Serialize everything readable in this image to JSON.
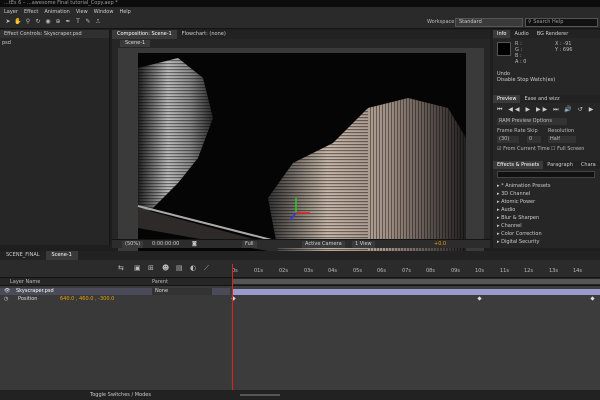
{
  "window": {
    "title": "...tEs 6 – ...awesome Final tutorial_Copy.aep *"
  },
  "menu": [
    "Layer",
    "Effect",
    "Animation",
    "View",
    "Window",
    "Help"
  ],
  "toolbar": {
    "workspace_label": "Workspace:",
    "workspace_value": "Standard",
    "search_placeholder": "Search Help"
  },
  "effect_controls": {
    "tab": "Effect Controls: Skyscraper.psd",
    "item": "psd"
  },
  "composition": {
    "tab": "Composition: Scene-1",
    "flowchart_tab": "Flowchart: (none)",
    "scene_tab": "Scene-1",
    "zoom": "(50%)",
    "timecode": "0:00:00:00",
    "resolution": "Full",
    "camera": "Active Camera",
    "views": "1 View",
    "exposure": "+0.0"
  },
  "info_panel": {
    "tabs": [
      "Info",
      "Audio",
      "BG Renderer"
    ],
    "labels": [
      "R :",
      "G :",
      "B :",
      "A : 0"
    ],
    "coords": [
      "X : -91",
      "Y : 696"
    ],
    "undo_title": "Undo",
    "undo_detail": "Disable Stop Watch(es)"
  },
  "preview_panel": {
    "tabs": [
      "Preview",
      "Ease and wizz"
    ],
    "ram_options": "RAM Preview Options",
    "frame_rate_label": "Frame Rate",
    "skip_label": "Skip",
    "resolution_label": "Resolution",
    "frame_rate_value": "(30)",
    "skip_value": "0",
    "resolution_value": "Half",
    "from_current": "From Current Time",
    "full_screen": "Full Screen"
  },
  "effects_panel": {
    "tabs": [
      "Effects & Presets",
      "Paragraph",
      "Chara"
    ],
    "items": [
      "* Animation Presets",
      "3D Channel",
      "Atomic Power",
      "Audio",
      "Blur & Sharpen",
      "Channel",
      "Color Correction",
      "Digital Security"
    ]
  },
  "timeline": {
    "tabs": [
      "SCENE_FINAL",
      "Scene-1"
    ],
    "col_layer_name": "Layer Name",
    "col_parent": "Parent",
    "layer_name": "Skyscraper.psd",
    "parent_value": "None",
    "property": "Position",
    "position_value": "640.0 , 460.0 , -300.0",
    "ruler_ticks": [
      "0s",
      "01s",
      "02s",
      "03s",
      "04s",
      "05s",
      "06s",
      "07s",
      "08s",
      "09s",
      "10s",
      "11s",
      "12s",
      "13s",
      "14s"
    ],
    "toggle_label": "Toggle Switches / Modes"
  },
  "colors": {
    "accent_orange": "#e8a000",
    "track_purple": "#9a9acc",
    "playhead_red": "#dd2222"
  }
}
